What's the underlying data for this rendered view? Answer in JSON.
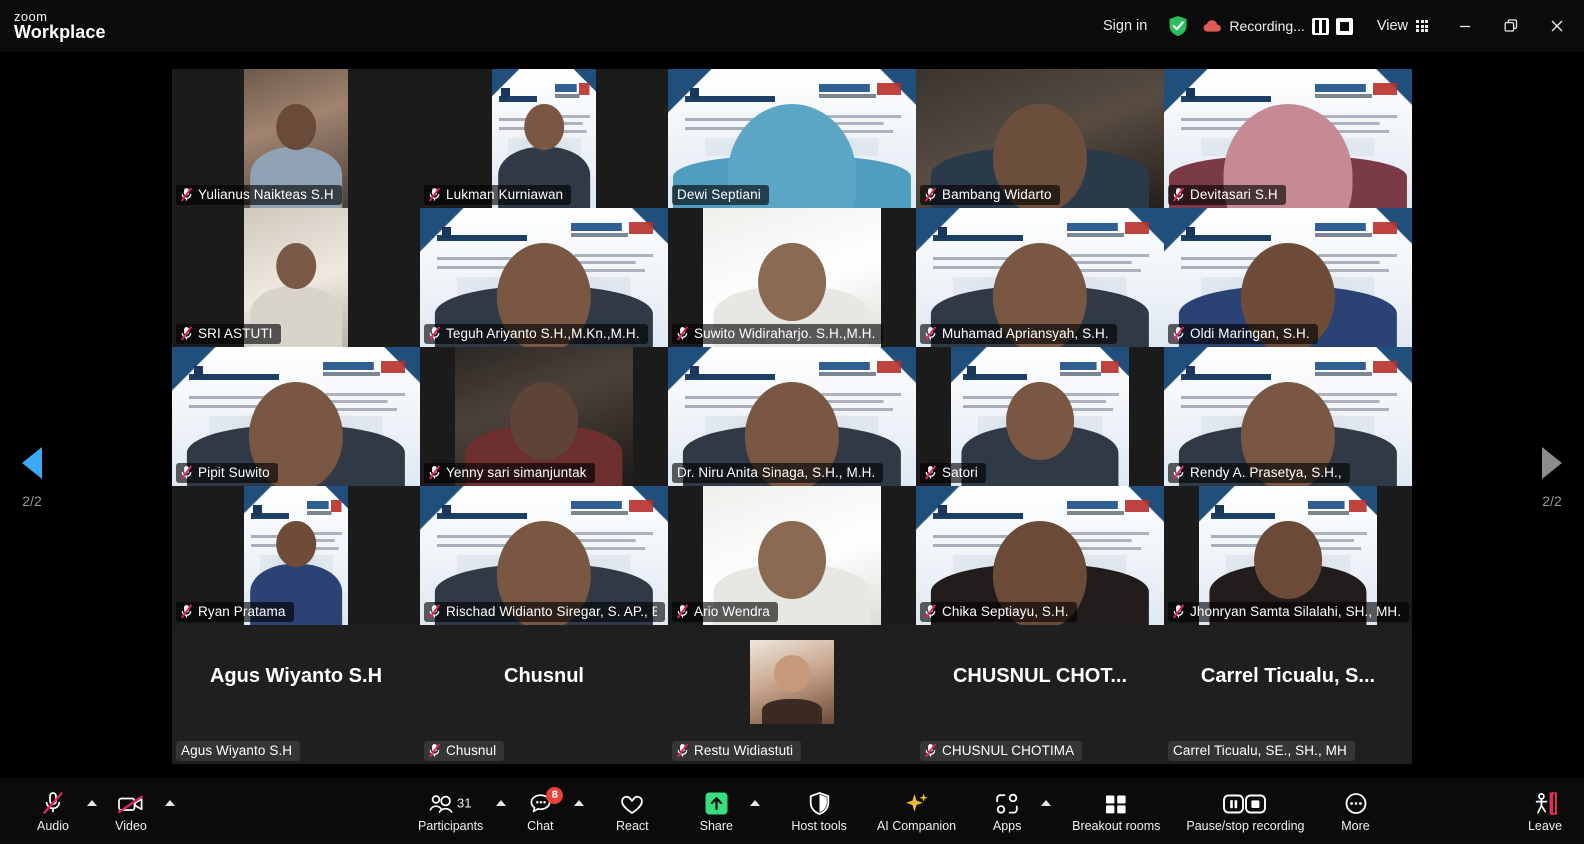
{
  "app": {
    "brand_line1": "zoom",
    "brand_line2": "Workplace"
  },
  "titlebar": {
    "sign_in": "Sign in",
    "shield_icon": "shield-check-icon",
    "recording_icon": "cloud-recording-icon",
    "recording_label": "Recording...",
    "pause_recording_icon": "pause-icon",
    "stop_recording_icon": "stop-icon",
    "view_label": "View",
    "view_icon": "grid-view-icon",
    "minimize_icon": "minimize-icon",
    "maximize_icon": "restore-window-icon",
    "close_icon": "close-icon"
  },
  "pager": {
    "prev_icon": "chevron-left-icon",
    "next_icon": "chevron-right-icon",
    "prev_count": "2/2",
    "next_count": "2/2",
    "accent_active": "#3da9f5",
    "accent_inactive": "#8c8c8c"
  },
  "gallery": {
    "speaking_border_color": "#35d07f",
    "tiles": [
      {
        "name": "Yulianus Naikteas S.H",
        "muted": true,
        "speaking": false,
        "video": true,
        "style": "room",
        "frame": "narrow"
      },
      {
        "name": "Lukman Kurniawan",
        "muted": true,
        "speaking": false,
        "video": true,
        "style": "vbg",
        "frame": "narrow"
      },
      {
        "name": "Dewi Septiani",
        "muted": false,
        "speaking": true,
        "video": true,
        "style": "vbg-hijab",
        "frame": "full"
      },
      {
        "name": "Bambang Widarto",
        "muted": true,
        "speaking": false,
        "video": true,
        "style": "room-dark",
        "frame": "full"
      },
      {
        "name": "Devitasari S.H",
        "muted": true,
        "speaking": false,
        "video": true,
        "style": "vbg-hijab-pink",
        "frame": "full"
      },
      {
        "name": "SRI ASTUTI",
        "muted": true,
        "speaking": false,
        "video": true,
        "style": "room-light",
        "frame": "narrow"
      },
      {
        "name": "Teguh Ariyanto S.H.,M.Kn.,M.H.",
        "muted": true,
        "speaking": false,
        "video": true,
        "style": "vbg",
        "frame": "full"
      },
      {
        "name": "Suwito Widiraharjo. S.H.,M.H.",
        "muted": true,
        "speaking": false,
        "video": true,
        "style": "room-white",
        "frame": "mid"
      },
      {
        "name": "Muhamad Apriansyah, S.H.",
        "muted": true,
        "speaking": false,
        "video": true,
        "style": "vbg",
        "frame": "full"
      },
      {
        "name": "Oldi Maringan, S.H.",
        "muted": true,
        "speaking": false,
        "video": true,
        "style": "vbg-batik",
        "frame": "full"
      },
      {
        "name": "Pipit Suwito",
        "muted": true,
        "speaking": false,
        "video": true,
        "style": "vbg",
        "frame": "full"
      },
      {
        "name": "Yenny sari simanjuntak",
        "muted": true,
        "speaking": false,
        "video": true,
        "style": "room-lamp",
        "frame": "mid"
      },
      {
        "name": "Dr. Niru Anita Sinaga, S.H., M.H.",
        "muted": false,
        "speaking": false,
        "video": true,
        "style": "vbg",
        "frame": "full"
      },
      {
        "name": "Satori",
        "muted": true,
        "speaking": false,
        "video": true,
        "style": "vbg",
        "frame": "mid"
      },
      {
        "name": "Rendy A. Prasetya, S.H.,",
        "muted": true,
        "speaking": false,
        "video": true,
        "style": "vbg",
        "frame": "full"
      },
      {
        "name": "Ryan Pratama",
        "muted": true,
        "speaking": false,
        "video": true,
        "style": "vbg-batik",
        "frame": "narrow"
      },
      {
        "name": "Rischad Widianto Siregar, S. AP., BKP.",
        "muted": true,
        "speaking": false,
        "video": true,
        "style": "vbg",
        "frame": "full"
      },
      {
        "name": "Ario Wendra",
        "muted": true,
        "speaking": false,
        "video": true,
        "style": "room-white",
        "frame": "mid"
      },
      {
        "name": "Chika Septiayu, S.H.",
        "muted": true,
        "speaking": false,
        "video": true,
        "style": "vbg-dark",
        "frame": "full"
      },
      {
        "name": "Jhonryan Samta Silalahi, SH., MH.",
        "muted": true,
        "speaking": false,
        "video": true,
        "style": "vbg-dark",
        "frame": "mid"
      },
      {
        "name": "Agus Wiyanto S.H",
        "display_name": "Agus Wiyanto S.H",
        "muted": false,
        "speaking": false,
        "video": false,
        "avatar": "initials"
      },
      {
        "name": "Chusnul",
        "display_name": "Chusnul",
        "muted": true,
        "speaking": false,
        "video": false,
        "avatar": "initials"
      },
      {
        "name": "Restu Widiastuti",
        "display_name": "",
        "muted": true,
        "speaking": false,
        "video": false,
        "avatar": "photo"
      },
      {
        "name": "CHUSNUL CHOTIMA",
        "display_name": "CHUSNUL  CHOT...",
        "muted": true,
        "speaking": false,
        "video": false,
        "avatar": "initials"
      },
      {
        "name": "Carrel Ticualu, SE., SH., MH",
        "display_name": "Carrel Ticualu,  S...",
        "muted": false,
        "speaking": false,
        "video": false,
        "avatar": "initials"
      }
    ]
  },
  "toolbar": {
    "audio": {
      "label": "Audio",
      "icon": "microphone-muted-icon",
      "has_caret": true
    },
    "video": {
      "label": "Video",
      "icon": "camera-off-icon",
      "has_caret": true
    },
    "participants": {
      "label": "Participants",
      "icon": "participants-icon",
      "count": "31",
      "has_caret": true
    },
    "chat": {
      "label": "Chat",
      "icon": "chat-icon",
      "badge": "8",
      "has_caret": true
    },
    "react": {
      "label": "React",
      "icon": "heart-icon",
      "has_caret": false
    },
    "share": {
      "label": "Share",
      "icon": "share-screen-icon",
      "has_caret": true,
      "color": "#36e07f"
    },
    "host_tools": {
      "label": "Host tools",
      "icon": "shield-icon",
      "has_caret": false
    },
    "ai_companion": {
      "label": "AI Companion",
      "icon": "sparkle-icon",
      "has_caret": false,
      "color": "#e8b83a"
    },
    "apps": {
      "label": "Apps",
      "icon": "apps-icon",
      "has_caret": true
    },
    "breakout": {
      "label": "Breakout rooms",
      "icon": "breakout-rooms-icon",
      "has_caret": false
    },
    "recording": {
      "label": "Pause/stop recording",
      "icon": "pause-stop-recording-icon",
      "has_caret": false
    },
    "more": {
      "label": "More",
      "icon": "ellipsis-icon",
      "has_caret": false
    },
    "leave": {
      "label": "Leave",
      "icon": "leave-meeting-icon",
      "color": "#e02b5a"
    }
  }
}
